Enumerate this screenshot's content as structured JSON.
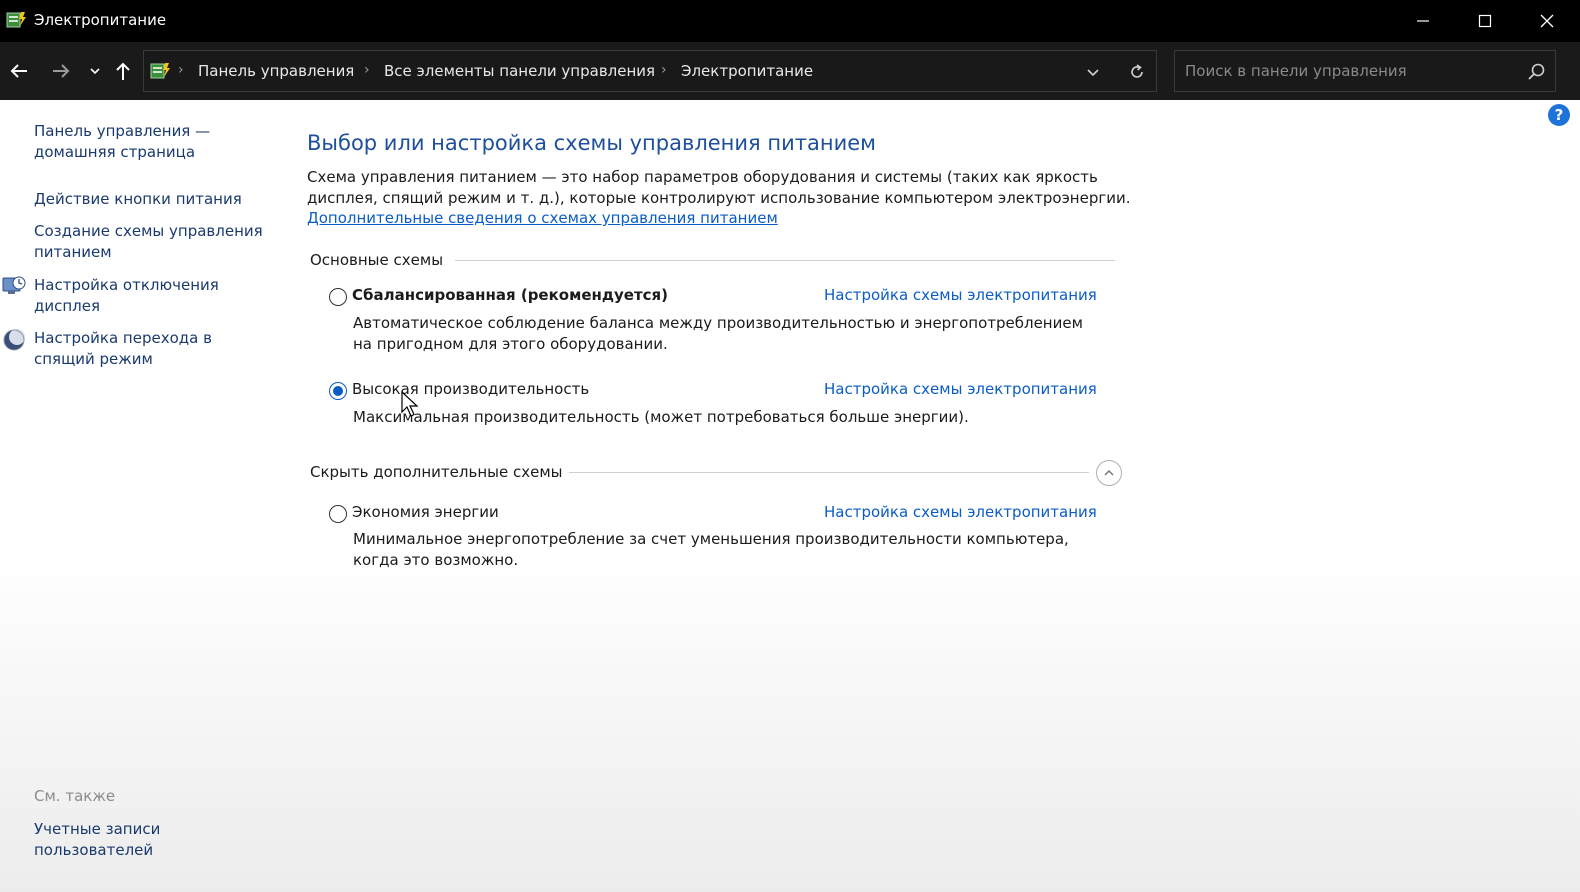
{
  "window": {
    "title": "Электропитание"
  },
  "address_bar": {
    "breadcrumbs": [
      "Панель управления",
      "Все элементы панели управления",
      "Электропитание"
    ]
  },
  "search": {
    "placeholder": "Поиск в панели управления"
  },
  "left_nav": {
    "home_line1": "Панель управления —",
    "home_line2": "домашняя страница",
    "power_button": "Действие кнопки питания",
    "create_plan_line1": "Создание схемы управления",
    "create_plan_line2": "питанием",
    "display_off_line1": "Настройка отключения",
    "display_off_line2": "дисплея",
    "sleep_line1": "Настройка перехода в",
    "sleep_line2": "спящий режим",
    "see_also": "См. также",
    "user_accounts_line1": "Учетные записи",
    "user_accounts_line2": "пользователей"
  },
  "main": {
    "title": "Выбор или настройка схемы управления питанием",
    "description_line1": "Схема управления питанием — это набор параметров оборудования и системы (таких как яркость",
    "description_line2": "дисплея, спящий режим и т. д.), которые контролируют использование компьютером электроэнергии.",
    "more_link": "Дополнительные сведения о схемах управления питанием",
    "primary_group_title": "Основные схемы",
    "hidden_group_title": "Скрыть дополнительные схемы",
    "plans": [
      {
        "name": "Сбалансированная (рекомендуется)",
        "selected": false,
        "link": "Настройка схемы электропитания",
        "desc_line1": "Автоматическое соблюдение баланса между производительностью и энергопотреблением",
        "desc_line2": "на пригодном для этого оборудовании."
      },
      {
        "name": "Высокая производительность",
        "selected": true,
        "link": "Настройка схемы электропитания",
        "desc_line1": "Максимальная производительность (может потребоваться больше энергии).",
        "desc_line2": ""
      },
      {
        "name": "Экономия энергии",
        "selected": false,
        "link": "Настройка схемы электропитания",
        "desc_line1": "Минимальное энергопотребление за счет уменьшения производительности компьютера,",
        "desc_line2": "когда это возможно."
      }
    ]
  },
  "colors": {
    "accent": "#0b5cc7",
    "title_blue": "#1e4f9c",
    "titlebar": "#000000",
    "navbar": "#1a1a1a"
  }
}
